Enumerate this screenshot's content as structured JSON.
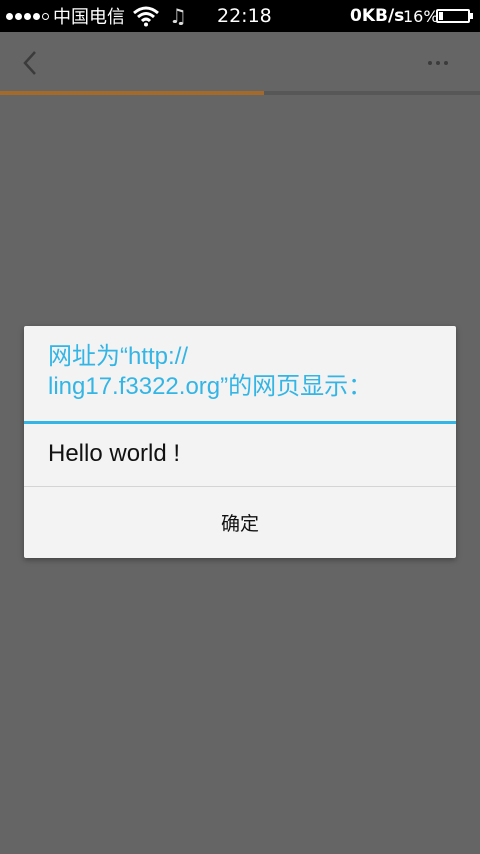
{
  "status_bar": {
    "carrier": "中国电信",
    "time": "22:18",
    "net_speed": "0KB/s",
    "battery_percent": "16%",
    "battery_level": 0.16,
    "signal_bars_filled": 4,
    "signal_bars_total": 5,
    "icons": [
      "signal-icon",
      "wifi-icon",
      "music-icon",
      "battery-icon"
    ]
  },
  "app_bar": {
    "back_icon": "chevron-left-icon",
    "more_icon": "more-dots-icon",
    "page_load_progress": 0.55
  },
  "dialog": {
    "title": "网址为“http://ling17.f3322.org”的网页显示：",
    "title_line1": "网址为“http://",
    "title_line2": "ling17.f3322.org”的网页显示：",
    "message": "Hello world !",
    "ok_label": "确定"
  },
  "colors": {
    "accent": "#33b5e5",
    "progress": "#a46a2c",
    "overlay": "#656565"
  }
}
